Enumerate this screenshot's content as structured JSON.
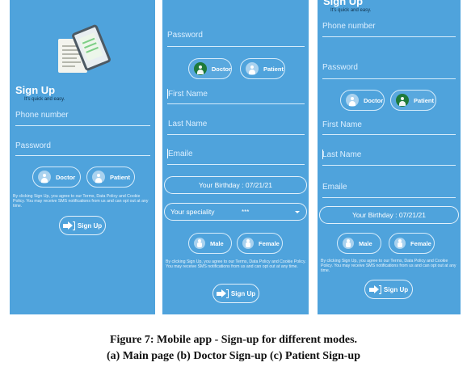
{
  "colors": {
    "panel_bg": "#4fa3dc",
    "selected_icon": "#1e7a3a"
  },
  "p1": {
    "title": "Sign Up",
    "subtitle": "It's quick and easy.",
    "phone": "Phone number",
    "password": "Password",
    "doctor": "Doctor",
    "patient": "Patient",
    "terms": "By clicking Sign Up, you agree to our Terms, Data Policy and Cookie Policy. You may receive SMS notifications from us and can opt out at any time.",
    "signup": "Sign Up"
  },
  "p2": {
    "password": "Password",
    "doctor": "Doctor",
    "patient": "Patient",
    "first_name": "First Name",
    "last_name": "Last Name",
    "email": "Emaile",
    "birthday": "Your Birthday : 07/21/21",
    "speciality": "Your speciality",
    "speciality_value": "***",
    "male": "Male",
    "female": "Female",
    "terms": "By clicking Sign Up, you agree to our Terms, Data Policy and Cookie Policy. You may receive SMS notifications from us and can opt out at any time.",
    "signup": "Sign Up"
  },
  "p3": {
    "title_partial": "Sign Up",
    "subtitle": "It's quick and easy.",
    "phone": "Phone number",
    "password": "Password",
    "doctor": "Doctor",
    "patient": "Patient",
    "first_name": "First Name",
    "last_name": "Last Name",
    "email": "Emaile",
    "birthday": "Your Birthday : 07/21/21",
    "male": "Male",
    "female": "Female",
    "terms": "By clicking Sign Up, you agree to our Terms, Data Policy and Cookie Policy. You may receive SMS notifications from us and can opt out at any time.",
    "signup": "Sign Up"
  },
  "caption": {
    "line1": "Figure 7: Mobile app - Sign-up for different modes.",
    "line2": "(a) Main page (b) Doctor Sign-up (c) Patient Sign-up"
  }
}
